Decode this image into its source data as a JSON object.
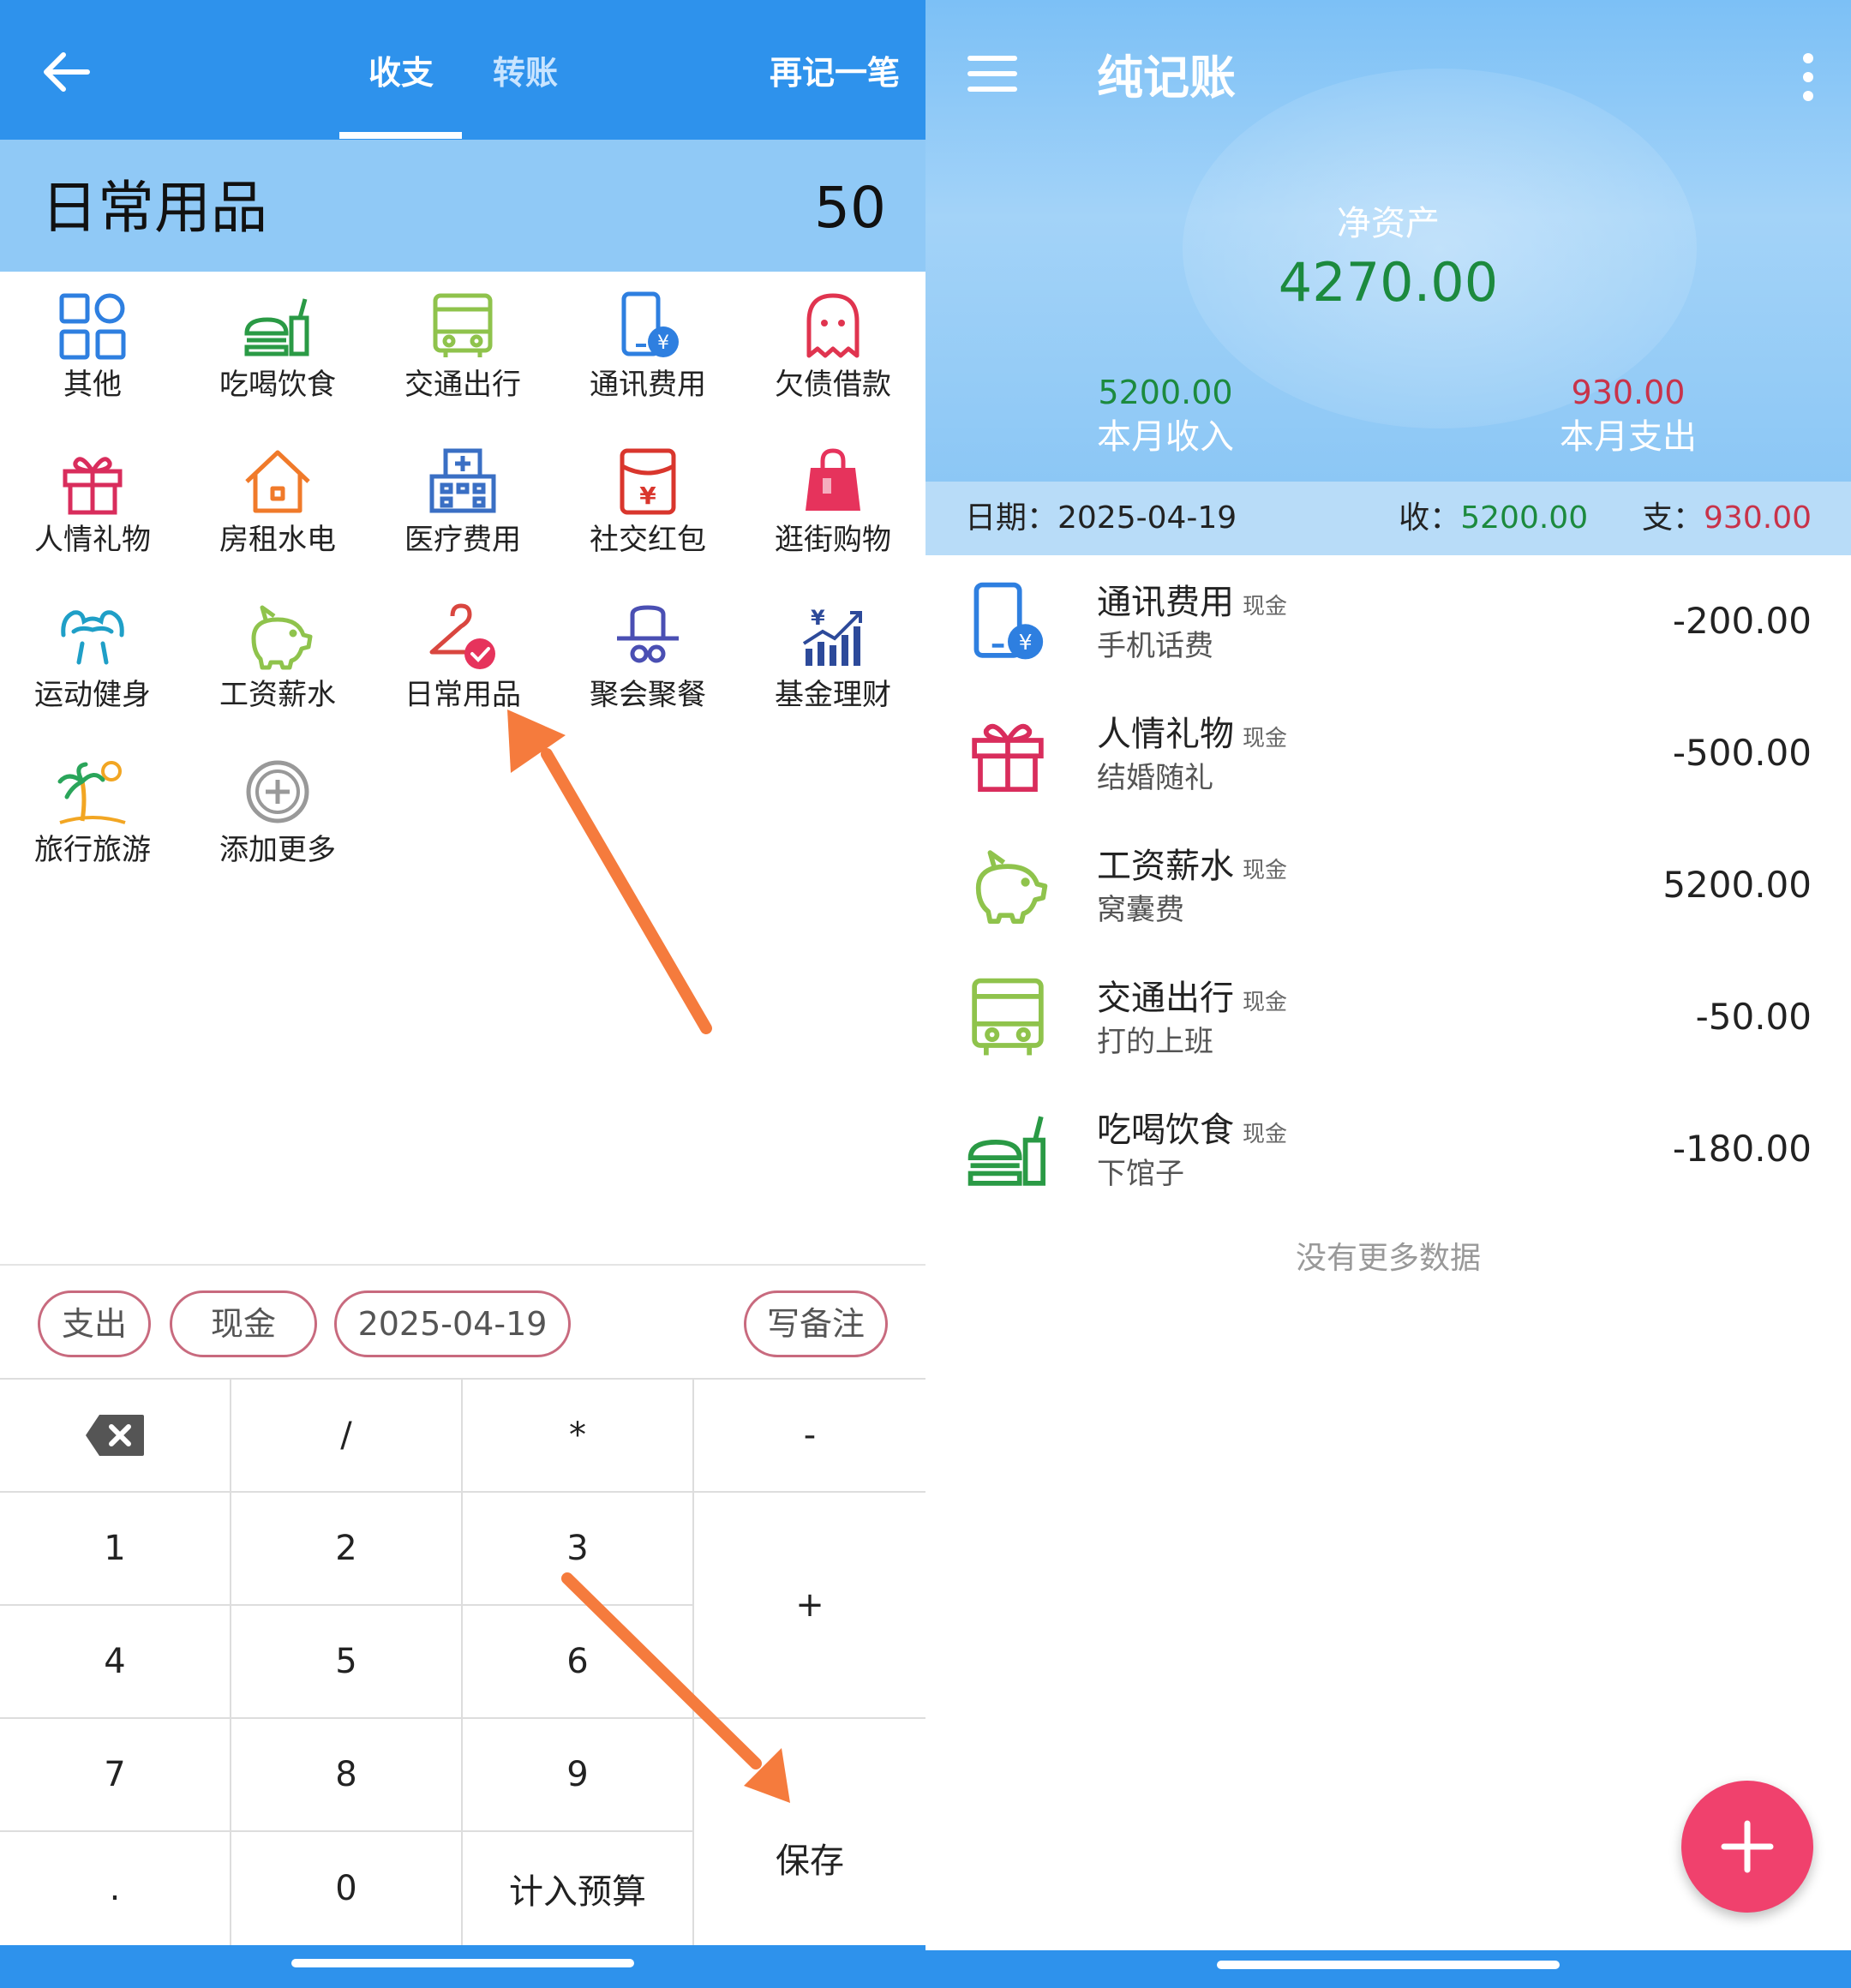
{
  "left": {
    "tabs": [
      "收支",
      "转账"
    ],
    "again_label": "再记一笔",
    "category": {
      "name": "日常用品",
      "amount": "50"
    },
    "categories": [
      "其他",
      "吃喝饮食",
      "交通出行",
      "通讯费用",
      "欠债借款",
      "人情礼物",
      "房租水电",
      "医疗费用",
      "社交红包",
      "逛街购物",
      "运动健身",
      "工资薪水",
      "日常用品",
      "聚会聚餐",
      "基金理财",
      "旅行旅游",
      "添加更多"
    ],
    "chips": {
      "type": "支出",
      "account": "现金",
      "date": "2025-04-19",
      "note": "写备注"
    },
    "keys": {
      "slash": "/",
      "star": "*",
      "minus": "-",
      "plus": "+",
      "k1": "1",
      "k2": "2",
      "k3": "3",
      "k4": "4",
      "k5": "5",
      "k6": "6",
      "k7": "7",
      "k8": "8",
      "k9": "9",
      "k0": "0",
      "dot": ".",
      "budget": "计入预算",
      "save": "保存"
    },
    "colors": {
      "accent": "#2e92ec",
      "arrow": "#f57b3d"
    }
  },
  "right": {
    "title": "纯记账",
    "net_label": "净资产",
    "net_value": "4270.00",
    "month_income": {
      "value": "5200.00",
      "label": "本月收入"
    },
    "month_expense": {
      "value": "930.00",
      "label": "本月支出"
    },
    "day": {
      "date": "日期：2025-04-19",
      "income_label": "收：",
      "income": "5200.00",
      "expense_label": "支：",
      "expense": "930.00"
    },
    "transactions": [
      {
        "name": "通讯费用",
        "account": "现金",
        "memo": "手机话费",
        "amount": "-200.00",
        "icon": "phone-icon"
      },
      {
        "name": "人情礼物",
        "account": "现金",
        "memo": "结婚随礼",
        "amount": "-500.00",
        "icon": "gift-icon"
      },
      {
        "name": "工资薪水",
        "account": "现金",
        "memo": "窝囊费",
        "amount": "5200.00",
        "icon": "piggy-bank-icon"
      },
      {
        "name": "交通出行",
        "account": "现金",
        "memo": "打的上班",
        "amount": "-50.00",
        "icon": "bus-icon"
      },
      {
        "name": "吃喝饮食",
        "account": "现金",
        "memo": "下馆子",
        "amount": "-180.00",
        "icon": "food-icon"
      }
    ],
    "no_more": "没有更多数据",
    "colors": {
      "income": "#1c8a3e",
      "expense": "#c8334a",
      "fab": "#f0416d"
    }
  }
}
